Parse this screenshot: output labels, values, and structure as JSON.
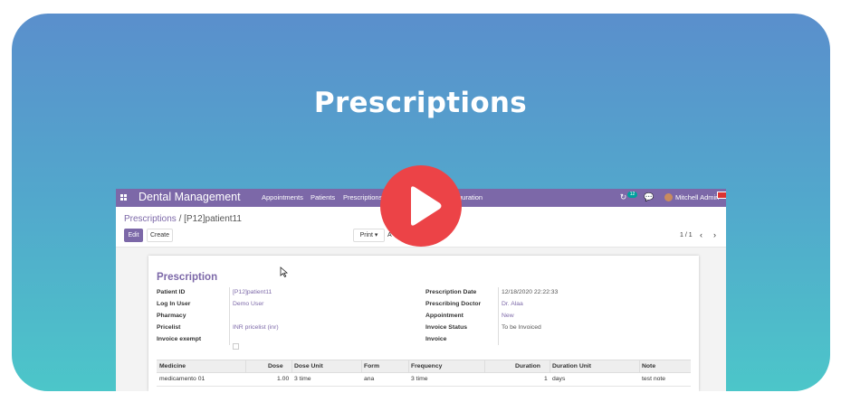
{
  "hero_title": "Prescriptions",
  "app": {
    "brand": "Dental Management",
    "nav": [
      "Appointments",
      "Patients",
      "Prescriptions",
      "guration"
    ],
    "badge": "12",
    "user": "Mitchell Admin"
  },
  "breadcrumb": {
    "parent": "Prescriptions",
    "separator": " / ",
    "current": "[P12]patient11"
  },
  "buttons": {
    "edit": "Edit",
    "create": "Create",
    "print": "Print",
    "action": "A"
  },
  "pager": "1 / 1",
  "form": {
    "title": "Prescription",
    "left_labels": [
      "Patient ID",
      "Log In User",
      "Pharmacy",
      "Pricelist",
      "Invoice exempt"
    ],
    "left_values": [
      "[P12]patient11",
      "Demo User",
      "",
      "INR pricelist (inr)",
      ""
    ],
    "right_labels": [
      "Prescription Date",
      "Prescribing Doctor",
      "Appointment",
      "Invoice Status",
      "Invoice"
    ],
    "right_values": [
      "12/18/2020 22:22:33",
      "Dr. Alaa",
      "New",
      "To be Invoiced",
      ""
    ]
  },
  "table": {
    "headers": [
      "Medicine",
      "Dose",
      "Dose Unit",
      "Form",
      "Frequency",
      "Duration",
      "Duration Unit",
      "Note"
    ],
    "rows": [
      [
        "medicamento 01",
        "1.00",
        "3 time",
        "ana",
        "3 time",
        "1",
        "days",
        "test note"
      ]
    ]
  },
  "colors": {
    "accent": "#7c68a8",
    "play": "#ec4347",
    "gradient_top": "#5a8fcc",
    "gradient_bottom": "#4cc6c9"
  }
}
